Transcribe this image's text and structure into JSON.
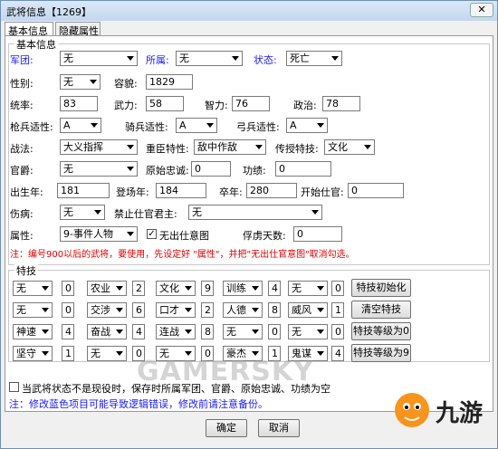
{
  "window": {
    "title": "武将信息【1269】",
    "close": "✕"
  },
  "tabs": [
    "基本信息",
    "隐藏属性"
  ],
  "basic": {
    "group_title": "基本信息",
    "junTuan_label": "军团:",
    "junTuan_value": "无",
    "suoShu_label": "所属:",
    "suoShu_value": "无",
    "zhuangTai_label": "状态:",
    "zhuangTai_value": "死亡",
    "xingBie_label": "性别:",
    "xingBie_value": "无",
    "rongMao_label": "容貌:",
    "rongMao_value": "1829",
    "tongShuai_label": "统率:",
    "tongShuai_value": "83",
    "wuLi_label": "武力:",
    "wuLi_value": "58",
    "zhiLi_label": "智力:",
    "zhiLi_value": "76",
    "zhengZhi_label": "政治:",
    "zhengZhi_value": "78",
    "qiang_label": "枪兵适性:",
    "qiang_value": "A",
    "qi_label": "骑兵适性:",
    "qi_value": "A",
    "gong_label": "弓兵适性:",
    "gong_value": "A",
    "zhanFa_label": "战法:",
    "zhanFa_value": "大义指挥",
    "chongChen_label": "重臣特性:",
    "chongChen_value": "敌中作敌",
    "chuanShou_label": "传授特技:",
    "chuanShou_value": "文化",
    "guanJue_label": "官爵:",
    "guanJue_value": "无",
    "yuanShi_label": "原始忠诚:",
    "yuanShi_value": "0",
    "gongJi_label": "功绩:",
    "gongJi_value": "0",
    "chuSheng_label": "出生年:",
    "chuSheng_value": "181",
    "dengChang_label": "登场年:",
    "dengChang_value": "184",
    "zuNian_label": "卒年:",
    "zuNian_value": "280",
    "kaiShi_label": "开始仕官:",
    "kaiShi_value": "0",
    "shangBing_label": "伤病:",
    "shangBing_value": "无",
    "jinZhi_label": "禁止仕官君主:",
    "jinZhi_value": "无",
    "shuXing_label": "属性:",
    "shuXing_value": "9-事件人物",
    "wuChu_label": "无出仕意图",
    "fuLu_label": "俘虏天数:",
    "fuLu_value": "0",
    "note": "注：编号900以后的武将，要使用，先设定好 \"属性\"，并把\"无出仕官意图\"取消勾选。"
  },
  "skills": {
    "group_title": "特技",
    "rows": [
      [
        {
          "name": "无",
          "lvl": "0"
        },
        {
          "name": "农业",
          "lvl": "2"
        },
        {
          "name": "文化",
          "lvl": "9"
        },
        {
          "name": "训练",
          "lvl": "4"
        },
        {
          "name": "无",
          "lvl": "0"
        }
      ],
      [
        {
          "name": "无",
          "lvl": "0"
        },
        {
          "name": "交涉",
          "lvl": "6"
        },
        {
          "name": "口才",
          "lvl": "2"
        },
        {
          "name": "人德",
          "lvl": "8"
        },
        {
          "name": "威风",
          "lvl": "1"
        }
      ],
      [
        {
          "name": "神速",
          "lvl": "4"
        },
        {
          "name": "奋战",
          "lvl": "4"
        },
        {
          "name": "连战",
          "lvl": "8"
        },
        {
          "name": "无",
          "lvl": "0"
        },
        {
          "name": "无",
          "lvl": "0"
        }
      ],
      [
        {
          "name": "坚守",
          "lvl": "1"
        },
        {
          "name": "无",
          "lvl": "0"
        },
        {
          "name": "无",
          "lvl": "0"
        },
        {
          "name": "豪杰",
          "lvl": "1"
        },
        {
          "name": "鬼谋",
          "lvl": "4"
        }
      ]
    ],
    "buttons": [
      "特技初始化",
      "清空特技",
      "特技等级为0",
      "特技等级为9"
    ]
  },
  "footer": {
    "checkbox_label": "当武将状态不是现役时，保存时所属军团、官爵、原始忠诚、功绩为空",
    "note": "注：修改蓝色项目可能导致逻辑错误，修改前请注意备份。",
    "ok": "确定",
    "cancel": "取消"
  },
  "watermark": "GAMERSKY",
  "logo": {
    "text": "九游"
  }
}
